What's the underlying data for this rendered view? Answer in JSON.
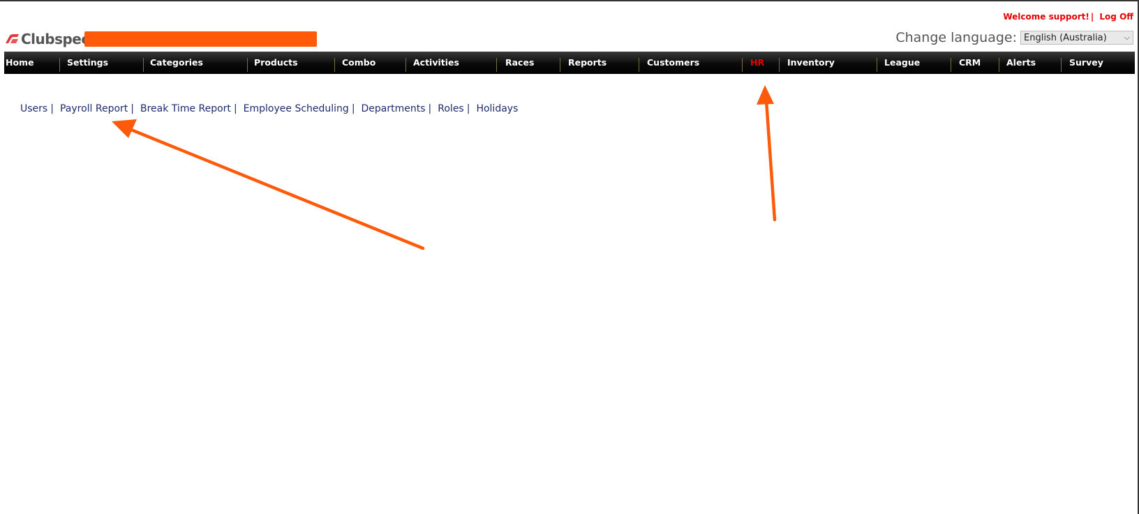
{
  "header": {
    "welcome_text": "Welcome support!",
    "separator": "|",
    "logoff_label": "Log Off",
    "logo_text": "Clubspeed",
    "change_language_label": "Change language:",
    "language_selected": "English (Australia)"
  },
  "nav": {
    "items": [
      {
        "label": "Home"
      },
      {
        "label": "Settings"
      },
      {
        "label": "Categories"
      },
      {
        "label": "Products"
      },
      {
        "label": "Combo"
      },
      {
        "label": "Activities"
      },
      {
        "label": "Races"
      },
      {
        "label": "Reports"
      },
      {
        "label": "Customers"
      },
      {
        "label": "HR"
      },
      {
        "label": "Inventory"
      },
      {
        "label": "League"
      },
      {
        "label": "CRM"
      },
      {
        "label": "Alerts"
      },
      {
        "label": "Survey"
      }
    ],
    "active": "HR"
  },
  "submenu": {
    "items": [
      {
        "label": "Users"
      },
      {
        "label": "Payroll Report"
      },
      {
        "label": "Break Time Report"
      },
      {
        "label": "Employee Scheduling"
      },
      {
        "label": "Departments"
      },
      {
        "label": "Roles"
      },
      {
        "label": "Holidays"
      }
    ],
    "separator": "|"
  },
  "colors": {
    "accent_red": "#e60000",
    "annotation_orange": "#ff5a0a",
    "link_blue": "#1f2a6b"
  },
  "icons": {
    "logo": "clubspeed-logo-icon",
    "select": "chevron-down-icon"
  }
}
